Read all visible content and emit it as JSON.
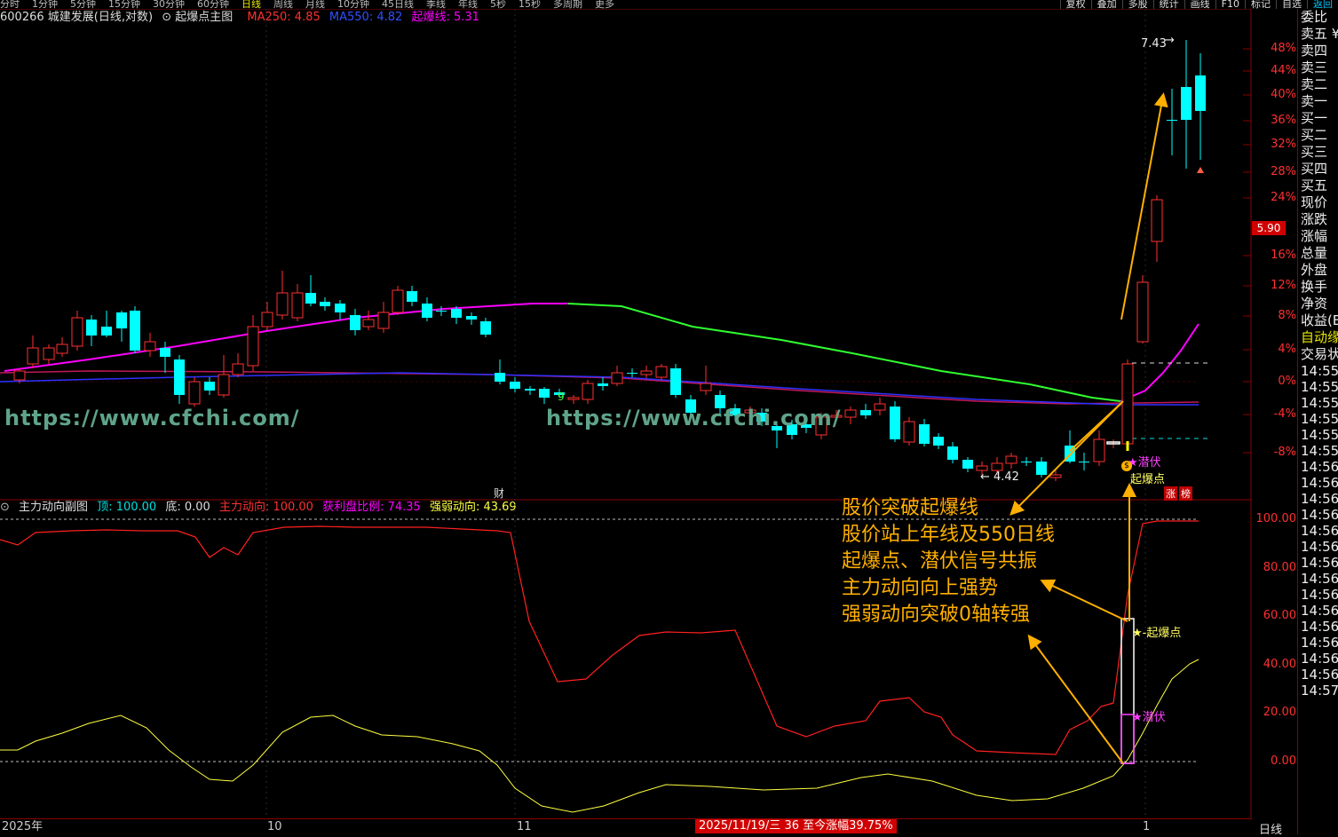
{
  "toolbar": {
    "periods": [
      "分时",
      "1分钟",
      "5分钟",
      "15分钟",
      "30分钟",
      "60分钟",
      "日线",
      "周线",
      "月线",
      "10分钟",
      "45日线",
      "季线",
      "年线",
      "5秒",
      "15秒",
      "多周期",
      "更多"
    ],
    "active_period": "日线",
    "tools": [
      "复权",
      "叠加",
      "多股",
      "统计",
      "画线",
      "F10",
      "标记",
      "自选",
      "返回"
    ]
  },
  "main_chart": {
    "symbol": "600266 城建发展(日线,对数)",
    "indicator": "起爆点主图",
    "ma250_label": "MA250: 4.85",
    "ma550_label": "MA550: 4.82",
    "qbx_label": "起爆线: 5.31",
    "high_label": "7.43",
    "low_label": "4.42",
    "current_price": "5.90",
    "y_axis": [
      "48%",
      "44%",
      "40%",
      "36%",
      "32%",
      "28%",
      "24%",
      "20%",
      "16%",
      "12%",
      "8%",
      "4%",
      "0%",
      "-4%",
      "-8%"
    ],
    "signal_qianfu": "潜伏",
    "signal_qibao": "起爆点",
    "zhang_label": "涨",
    "bang_label": "榜",
    "cai_label": "财",
    "nine_label": "9"
  },
  "sub_chart": {
    "title": "主力动向副图",
    "top_label": "顶: 100.00",
    "bottom_label": "底: 0.00",
    "zldx_label": "主力动向: 100.00",
    "hlp_label": "获利盘比例: 74.35",
    "qrdx_label": "强弱动向: 43.69",
    "y_axis": [
      "100.00",
      "80.00",
      "60.00",
      "40.00",
      "20.00",
      "0.00"
    ],
    "signal_qibao": "★-起爆点",
    "signal_qianfu": "★潜伏"
  },
  "watermark": "https://www.cfchi.com/",
  "annotations": [
    "股价突破起爆线",
    "股价站上年线及550日线",
    "起爆点、潜伏信号共振",
    "主力动向向上强势",
    "强弱动向突破0轴转强"
  ],
  "date_axis": {
    "year": "2025年",
    "oct": "10",
    "nov": "11",
    "dec": "1",
    "highlight": "2025/11/19/三 36 至今涨幅39.75%",
    "day_button": "日线"
  },
  "right_panel": {
    "labels": [
      "委比",
      "卖五 ¥",
      "卖四",
      "卖三",
      "卖二",
      "卖一",
      "买一",
      "买二",
      "买三",
      "买四",
      "买五",
      "现价",
      "涨跌",
      "涨幅",
      "总量",
      "外盘",
      "换手",
      "净资",
      "收益(E",
      "自动缘",
      "交易状"
    ],
    "times": [
      "14:55",
      "14:55",
      "14:55",
      "14:55",
      "14:55",
      "14:55",
      "14:56",
      "14:56",
      "14:56",
      "14:56",
      "14:56",
      "14:56",
      "14:56",
      "14:56",
      "14:56",
      "14:56",
      "14:56",
      "14:56",
      "14:56",
      "14:56",
      "14:57"
    ]
  },
  "colors": {
    "up": "#ff3030",
    "down": "#00ffff",
    "ma250": "#c0185a",
    "ma550": "#3030ff",
    "qbx_up": "#ff00ff",
    "qbx_down": "#30ff30",
    "accent": "#ffb000"
  }
}
